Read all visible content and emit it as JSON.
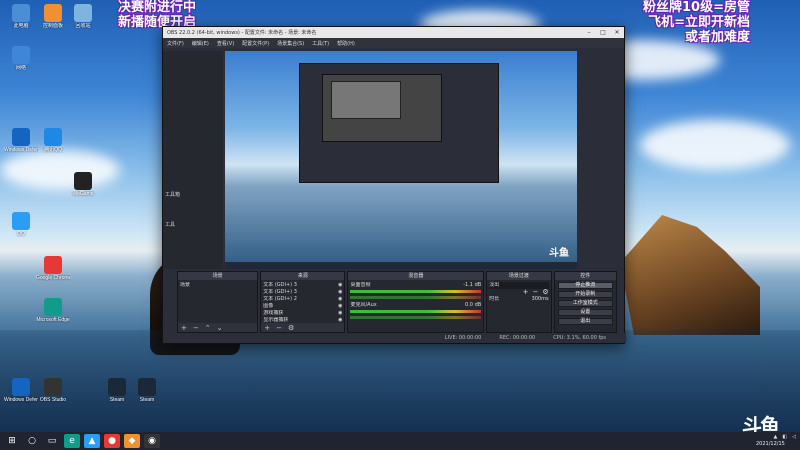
{
  "overlay": {
    "left_line1": "决赛附进行中",
    "left_line2": "新播随便开启",
    "right_line1": "粉丝牌10级=房管",
    "right_line2": "飞机=立即开新档",
    "right_line3": "或者加难度"
  },
  "desktop_icons": [
    {
      "label": "此电脑",
      "color": "#4a8fd6"
    },
    {
      "label": "回收站",
      "color": "#7fb3e0"
    },
    {
      "label": "网络",
      "color": "#3f86d6"
    },
    {
      "label": "控制面板",
      "color": "#f09030"
    },
    {
      "label": "QQ",
      "color": "#2a9df4"
    },
    {
      "label": "腾讯QQ",
      "color": "#1e88e5"
    },
    {
      "label": "Windows Defender",
      "color": "#1565c0"
    },
    {
      "label": "Microsoft Edge",
      "color": "#0f9d8a"
    },
    {
      "label": "WeGame",
      "color": "#222222"
    },
    {
      "label": "Google Chrome",
      "color": "#e53935"
    },
    {
      "label": "OBS Studio",
      "color": "#333333"
    },
    {
      "label": "Steam",
      "color": "#1b2838"
    }
  ],
  "obs": {
    "title": "OBS 22.0.2 (64-bit, windows) - 配置文件: 未命名 - 场景: 未命名",
    "menu": [
      "文件(F)",
      "编辑(E)",
      "查看(V)",
      "配置文件(P)",
      "场景集合(S)",
      "工具(T)",
      "帮助(H)"
    ],
    "left_labels": [
      "工具箱",
      "工具"
    ],
    "docks": {
      "scenes": {
        "title": "场景",
        "items": [
          "场景"
        ]
      },
      "sources": {
        "title": "来源",
        "items": [
          "文本 (GDI+) 3",
          "文本 (GDI+) 3",
          "文本 (GDI+) 2",
          "图像",
          "游戏捕获",
          "显示器捕获"
        ]
      },
      "mixer": {
        "title": "混音器",
        "tracks": [
          {
            "name": "桌面音频",
            "db": "-1.1 dB"
          },
          {
            "name": "麦克风/Aux",
            "db": "0.0 dB"
          }
        ]
      },
      "transitions": {
        "title": "场景过渡",
        "type": "淡出",
        "duration_label": "时长",
        "duration": "300ms"
      },
      "controls": {
        "title": "控件",
        "buttons": [
          "停止推流",
          "开始录制",
          "工作室模式",
          "设置",
          "退出"
        ]
      }
    },
    "status": {
      "live": "LIVE: 00:00:00",
      "rec": "REC: 00:00:00",
      "cpu": "CPU: 3.1%, 60.00 fps"
    }
  },
  "taskbar": {
    "date": "2021/12/15",
    "brand": "斗鱼"
  }
}
